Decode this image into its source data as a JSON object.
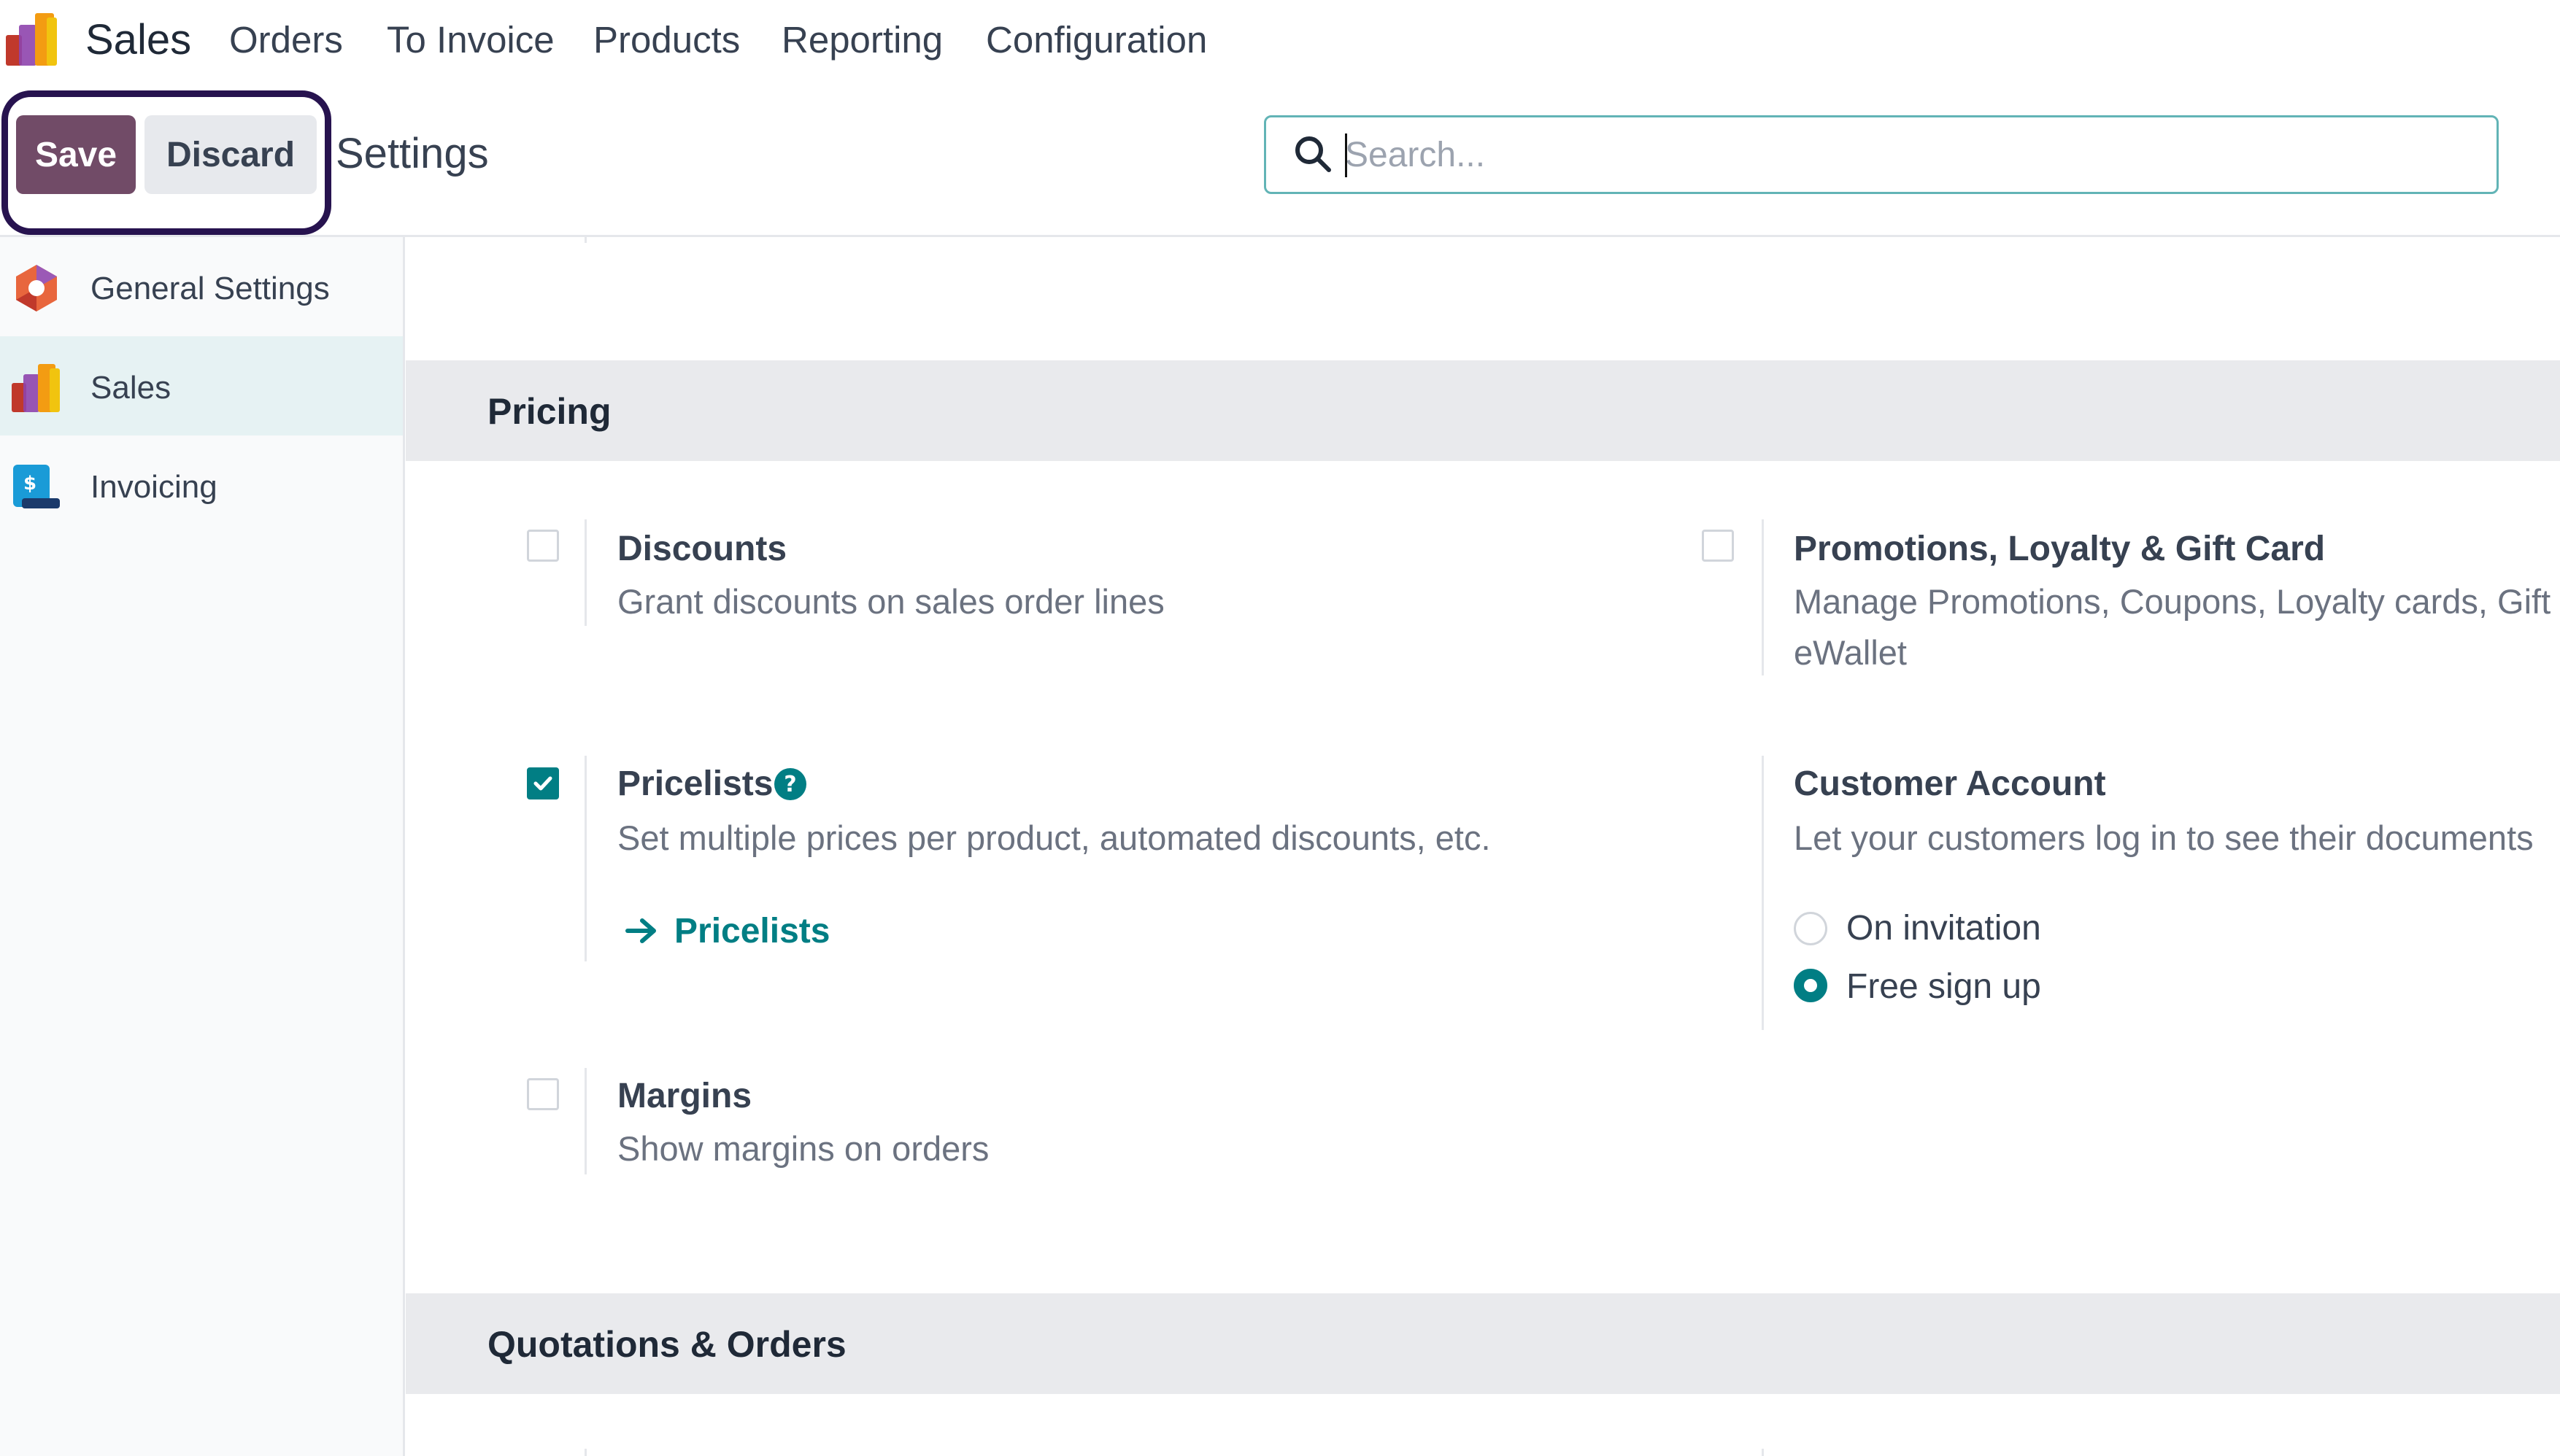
{
  "nav": {
    "app_name": "Sales",
    "menu": [
      "Orders",
      "To Invoice",
      "Products",
      "Reporting",
      "Configuration"
    ],
    "logo_icon": "sales-app-logo-icon"
  },
  "control_panel": {
    "save_label": "Save",
    "discard_label": "Discard",
    "title": "Settings",
    "search_placeholder": "Search...",
    "search_icon": "magnifier-icon"
  },
  "sidebar": {
    "items": [
      {
        "label": "General Settings",
        "icon": "general-settings-icon",
        "active": false
      },
      {
        "label": "Sales",
        "icon": "sales-app-icon",
        "active": true
      },
      {
        "label": "Invoicing",
        "icon": "invoicing-app-icon",
        "active": false
      }
    ]
  },
  "sections": {
    "pricing_title": "Pricing",
    "quotations_title": "Quotations & Orders"
  },
  "settings": {
    "discounts": {
      "title": "Discounts",
      "desc": "Grant discounts on sales order lines",
      "checked": false
    },
    "promotions": {
      "title": "Promotions, Loyalty & Gift Card",
      "desc_line1": "Manage Promotions, Coupons, Loyalty cards, Gift",
      "desc_line2": "eWallet",
      "checked": false
    },
    "pricelists": {
      "title": "Pricelists",
      "desc": "Set multiple prices per product, automated discounts, etc.",
      "checked": true,
      "link_label": "Pricelists"
    },
    "customer_account": {
      "title": "Customer Account",
      "desc": "Let your customers log in to see their documents",
      "options": [
        "On invitation",
        "Free sign up"
      ],
      "selected": "Free sign up"
    },
    "margins": {
      "title": "Margins",
      "desc": "Show margins on orders",
      "checked": false
    }
  },
  "colors": {
    "primary": "#714b67",
    "accent": "#017e84",
    "highlight_border": "#27134f",
    "section_bg": "#e9eaed"
  }
}
